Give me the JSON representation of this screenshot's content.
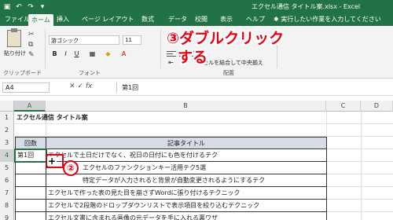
{
  "window": {
    "title": "エクセル通信 タイトル案.xlsx  -  Excel",
    "qat_icons": [
      "save-icon",
      "undo-icon",
      "redo-icon",
      "customize-icon"
    ]
  },
  "ribbon_tabs": [
    "ファイル",
    "ホーム",
    "挿入",
    "ページ レイアウト",
    "数式",
    "データ",
    "校閲",
    "表示",
    "ヘルプ"
  ],
  "active_tab": "ホーム",
  "tell_me": "実行したい作業を入力してください",
  "ribbon": {
    "paste_label": "貼り付け",
    "clipboard_group": "クリップボード",
    "font_name": "游ゴシック",
    "font_size": "11",
    "font_group": "フォント",
    "bold": "B",
    "italic": "I",
    "underline": "U",
    "merge_label": "セルを結合して中央揃え",
    "alignment_group": "配置"
  },
  "annotations": {
    "step3_line1": "③ダブルクリック",
    "step3_line2": "する",
    "step2": "②"
  },
  "formula_bar": {
    "name_box": "A4",
    "fx": "fx",
    "value": "第1回"
  },
  "columns": [
    "A",
    "B",
    "C",
    "D"
  ],
  "rows": [
    {
      "num": "1",
      "a": "エクセル通信 タイトル案",
      "b": ""
    },
    {
      "num": "2",
      "a": "",
      "b": ""
    },
    {
      "num": "3",
      "a": "回数",
      "b": "記事タイトル"
    },
    {
      "num": "4",
      "a": "第1回",
      "b": "エクセルで土日だけでなく、祝日の日付にも色を付けるテク"
    },
    {
      "num": "5",
      "a": "",
      "b": "エクセルのファンクションキー活用テク5選"
    },
    {
      "num": "6",
      "a": "",
      "b": "特定データが入力されると背景が自動変更されるようにするテク"
    },
    {
      "num": "7",
      "a": "",
      "b": "エクセルで作った表の見た目を崩さずWordに張り付けるテクニック"
    },
    {
      "num": "8",
      "a": "",
      "b": "エクセルで2段階のドロップダウンリストで表示項目を絞り込むテクニック"
    },
    {
      "num": "9",
      "a": "",
      "b": "エクセル文書に含まれる画像の元データを手に入れる裏ワザ"
    }
  ]
}
